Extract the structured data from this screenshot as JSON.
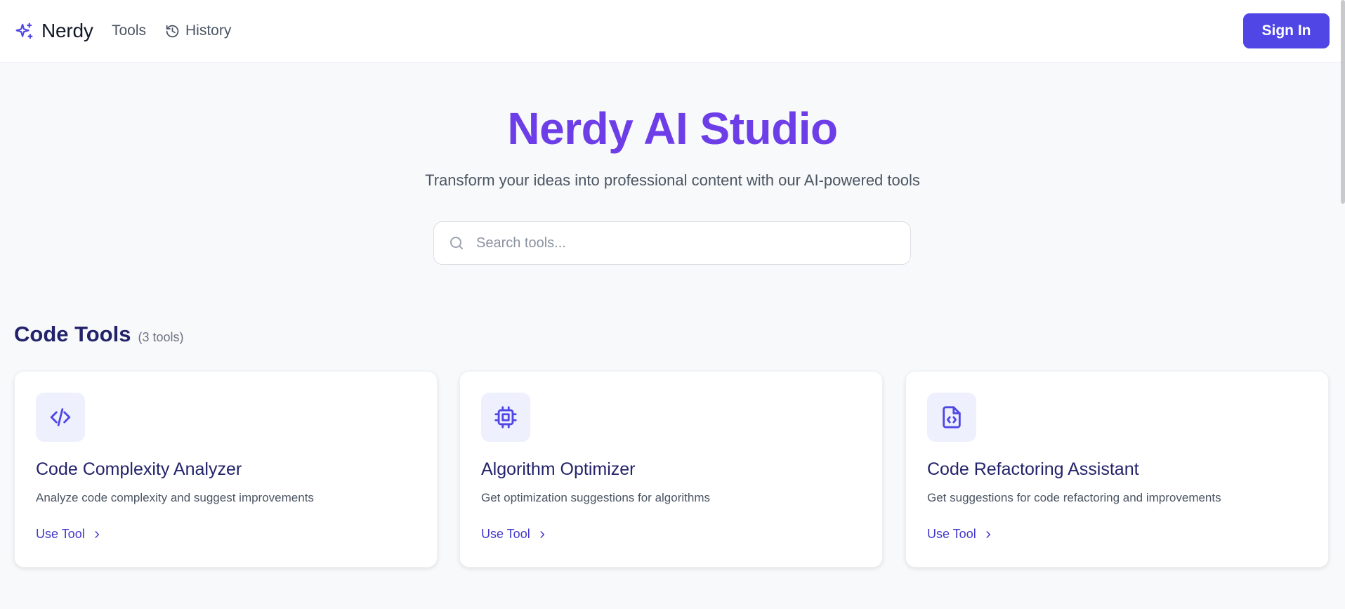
{
  "header": {
    "brand": "Nerdy",
    "nav": {
      "tools": "Tools",
      "history": "History"
    },
    "sign_in": "Sign In"
  },
  "hero": {
    "title": "Nerdy AI Studio",
    "subtitle": "Transform your ideas into professional content with our AI-powered tools"
  },
  "search": {
    "placeholder": "Search tools..."
  },
  "section": {
    "title": "Code Tools",
    "count": "(3 tools)"
  },
  "cards": [
    {
      "icon": "code-icon",
      "title": "Code Complexity Analyzer",
      "description": "Analyze code complexity and suggest improvements",
      "link": "Use Tool"
    },
    {
      "icon": "cpu-icon",
      "title": "Algorithm Optimizer",
      "description": "Get optimization suggestions for algorithms",
      "link": "Use Tool"
    },
    {
      "icon": "file-code-icon",
      "title": "Code Refactoring Assistant",
      "description": "Get suggestions for code refactoring and improvements",
      "link": "Use Tool"
    }
  ],
  "colors": {
    "accent": "#4f46e5",
    "hero_title": "#6d3ee8",
    "heading": "#23236b",
    "background": "#f8f9fa"
  }
}
